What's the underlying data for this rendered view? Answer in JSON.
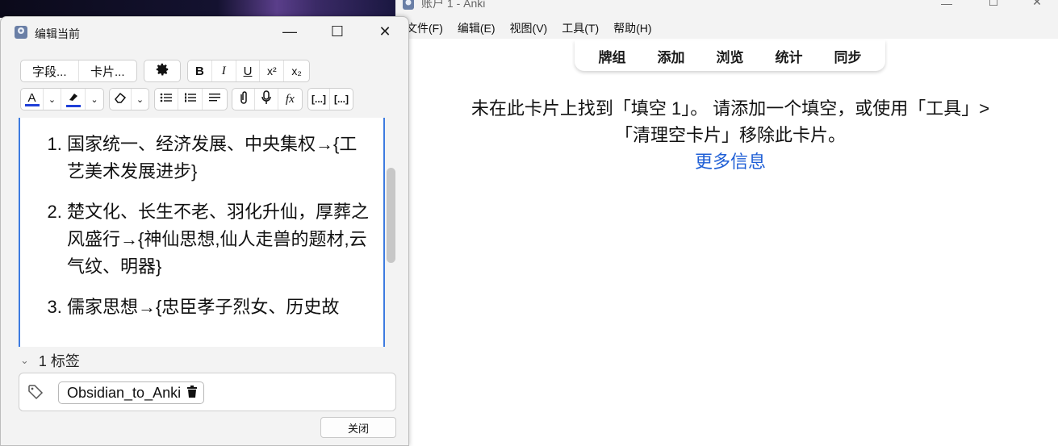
{
  "main_window": {
    "title": "账户 1 - Anki",
    "menu": [
      "文件(F)",
      "编辑(E)",
      "视图(V)",
      "工具(T)",
      "帮助(H)"
    ],
    "tabs": [
      "牌组",
      "添加",
      "浏览",
      "统计",
      "同步"
    ],
    "message_line1": "未在此卡片上找到「填空 1」。 请添加一个填空，或使用「工具」>",
    "message_line2": "「清理空卡片」移除此卡片。",
    "more_info_link": "更多信息"
  },
  "edit_window": {
    "title": "编辑当前",
    "toolbar": {
      "fields_button": "字段...",
      "cards_button": "卡片...",
      "bold": "B",
      "italic": "I",
      "underline": "U",
      "superscript": "x²",
      "subscript": "x₂",
      "text_color_letter": "A",
      "cloze_label": "[...]",
      "cloze_same_label": "[...]",
      "mathjax_label": "fx"
    },
    "list_items": [
      {
        "num": "1.",
        "text": "国家统一、经济发展、中央集权→{工艺美术发展进步}"
      },
      {
        "num": "2.",
        "text": "楚文化、长生不老、羽化升仙，厚葬之风盛行→{神仙思想,仙人走兽的题材,云气纹、明器}"
      },
      {
        "num": "3.",
        "text": "儒家思想→{忠臣孝子烈女、历史故"
      }
    ],
    "tags_count_label": "1 标签",
    "tag": "Obsidian_to_Anki",
    "close_button": "关闭"
  },
  "colors": {
    "accent_blue": "#3d7be0",
    "link_blue": "#1f5fd6",
    "text_color_underline": "#1f3fd8",
    "highlight_underline": "#1f3fd8"
  }
}
